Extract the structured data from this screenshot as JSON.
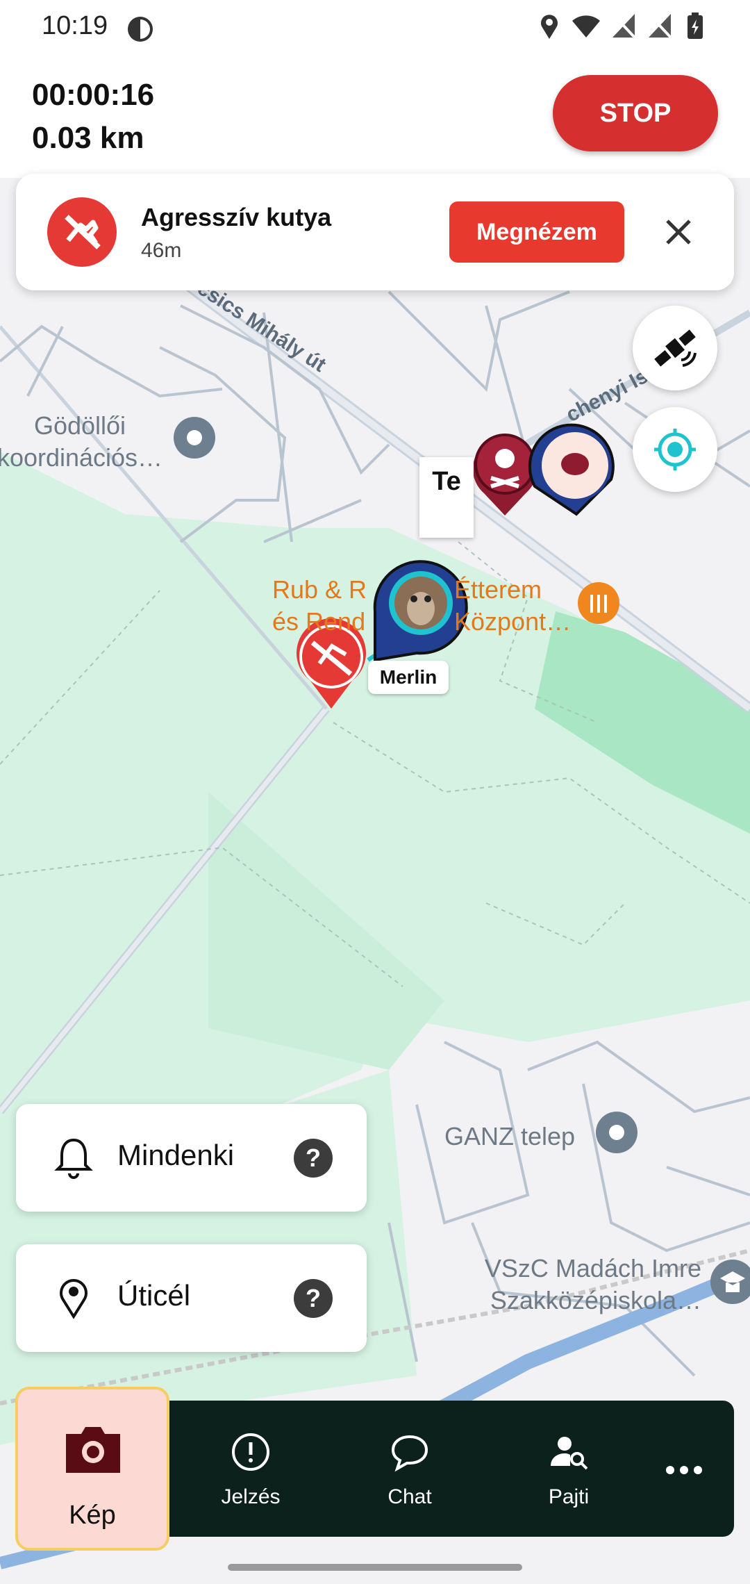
{
  "status_bar": {
    "time": "10:19"
  },
  "tracking": {
    "elapsed": "00:00:16",
    "distance": "0.03 km",
    "stop_label": "STOP"
  },
  "alert": {
    "title": "Agresszív kutya",
    "distance": "46m",
    "view_label": "Megnézem"
  },
  "map": {
    "street_labels": [
      "csics Mihály út",
      "chenyi Ist"
    ],
    "places": [
      {
        "name": "Gödöllői koordinációs…",
        "line1": "Gödöllői",
        "line2": "koordinációs…"
      },
      {
        "name": "Rub & R… Étterem és Rend… Központ…",
        "line1": "Rub & R",
        "line1b": "Étterem",
        "line2": "és Rend",
        "line2b": "Központ…"
      },
      {
        "name": "GANZ telep"
      },
      {
        "name": "VSzC Madách Imre Szakközépiskola…",
        "line1": "VSzC Madách Imre",
        "line2": "Szakközépiskola…"
      }
    ],
    "you_label": "Te",
    "pet_label": "Merlin"
  },
  "quick_cards": [
    {
      "label": "Mindenki",
      "icon": "bell-icon",
      "help": "?"
    },
    {
      "label": "Úticél",
      "icon": "location-pin-icon",
      "help": "?"
    }
  ],
  "bottom_nav": [
    {
      "label": "Kép",
      "icon": "camera-icon",
      "active": true
    },
    {
      "label": "Jelzés",
      "icon": "alert-circle-icon"
    },
    {
      "label": "Chat",
      "icon": "chat-bubble-icon"
    },
    {
      "label": "Pajti",
      "icon": "person-search-icon"
    },
    {
      "label": "",
      "icon": "more-horizontal-icon"
    }
  ],
  "colors": {
    "stop": "#d62f2f",
    "alert": "#e8392e",
    "park": "#d5f2e3",
    "nav_bg": "#0c211b",
    "accent": "#1fc3d0"
  }
}
